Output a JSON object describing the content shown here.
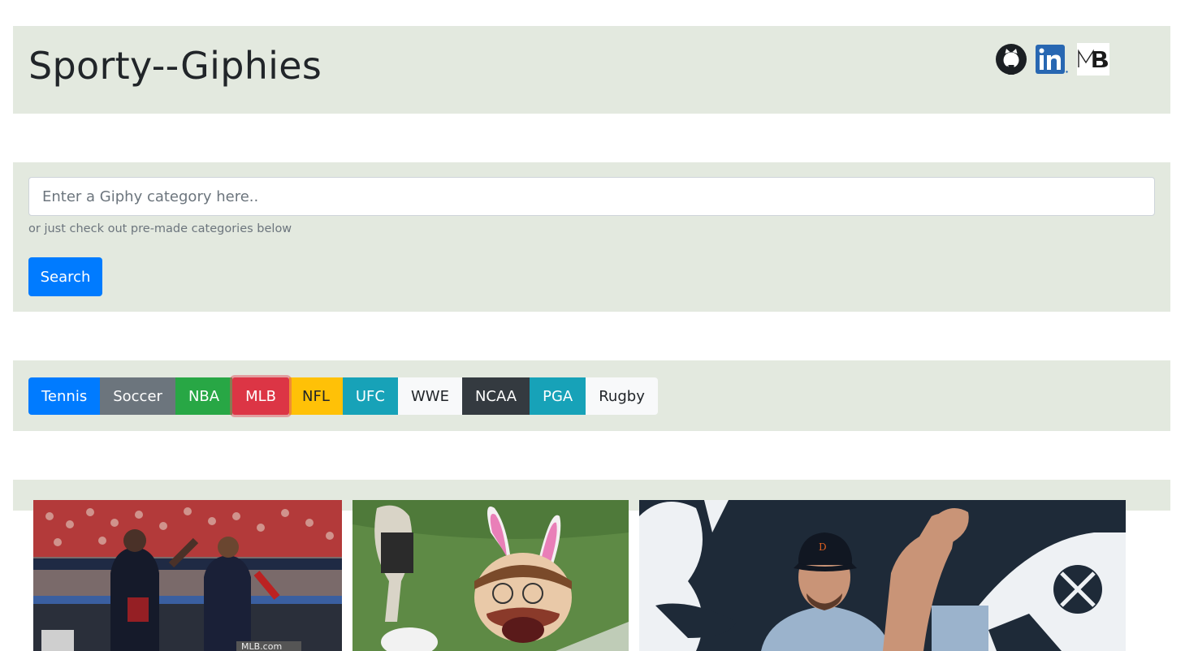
{
  "header": {
    "title": "Sporty--Giphies",
    "social": [
      {
        "name": "github-icon"
      },
      {
        "name": "linkedin-icon",
        "text": "in"
      },
      {
        "name": "mb-logo",
        "text": "MB"
      }
    ]
  },
  "search": {
    "placeholder": "Enter a Giphy category here..",
    "value": "",
    "hint": "or just check out pre-made categories below",
    "button_label": "Search"
  },
  "categories": [
    {
      "label": "Tennis",
      "bg": "#007bff",
      "fg": "#ffffff"
    },
    {
      "label": "Soccer",
      "bg": "#6c757d",
      "fg": "#ffffff"
    },
    {
      "label": "NBA",
      "bg": "#28a745",
      "fg": "#ffffff"
    },
    {
      "label": "MLB",
      "bg": "#dc3545",
      "fg": "#ffffff",
      "active": true
    },
    {
      "label": "NFL",
      "bg": "#ffc107",
      "fg": "#212529"
    },
    {
      "label": "UFC",
      "bg": "#17a2b8",
      "fg": "#ffffff"
    },
    {
      "label": "WWE",
      "bg": "#f8f9fa",
      "fg": "#212529"
    },
    {
      "label": "NCAA",
      "bg": "#343a40",
      "fg": "#ffffff"
    },
    {
      "label": "PGA",
      "bg": "#17a2b8",
      "fg": "#ffffff"
    },
    {
      "label": "Rugby",
      "bg": "#f8f9fa",
      "fg": "#212529"
    }
  ],
  "gifs": [
    {
      "name": "gif-baseball-dugout-celebration",
      "watermark": "MLB.com"
    },
    {
      "name": "gif-mascot-bunny-ears"
    },
    {
      "name": "gif-pitcher-clapping"
    }
  ],
  "colors": {
    "panel_bg": "#e3e9df",
    "primary": "#007bff"
  }
}
